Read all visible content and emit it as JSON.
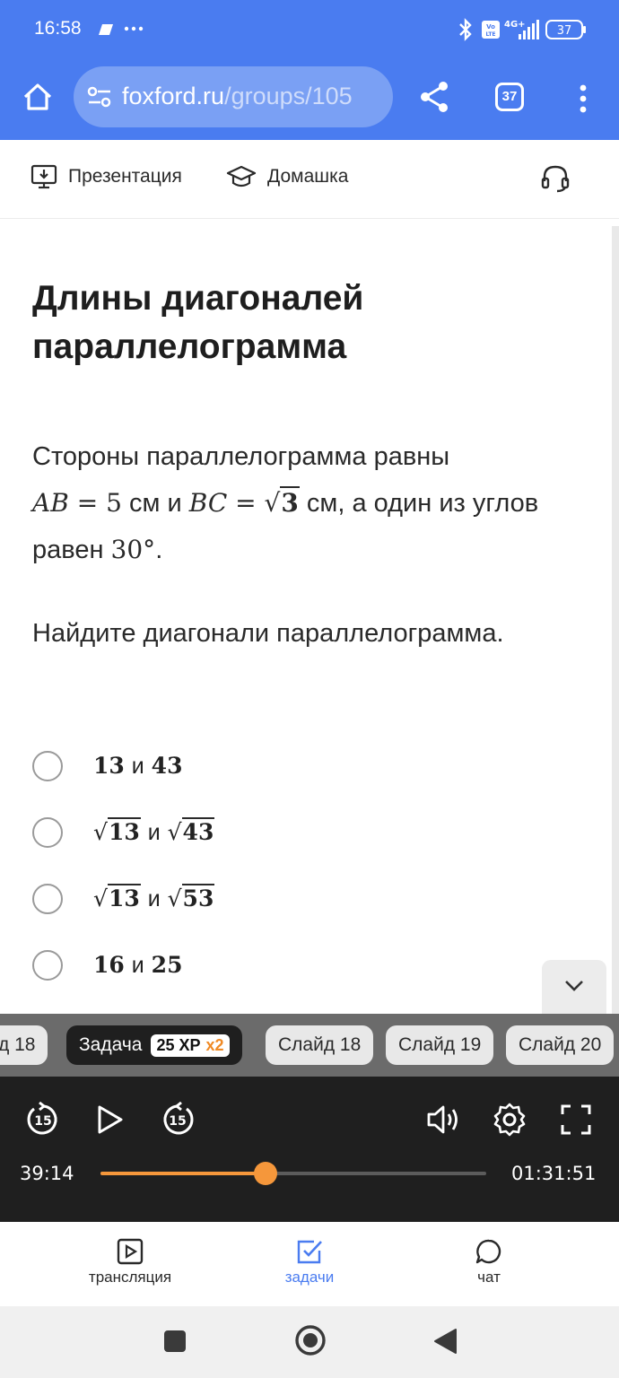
{
  "status_bar": {
    "time": "16:58",
    "battery": "37",
    "icons": [
      "cloud-icon",
      "more-dots-icon",
      "bluetooth-icon",
      "volte-icon",
      "signal-4g-icon",
      "battery-icon"
    ]
  },
  "browser": {
    "url_main": "foxford.ru",
    "url_path": "/groups/105",
    "tab_count": "37",
    "accent": "#4a7cf0"
  },
  "app_header": {
    "presentation": "Презентация",
    "homework": "Домашка"
  },
  "task": {
    "title": "Длины диагоналей параллелограмма",
    "statement": {
      "prefix": "Стороны параллелограмма равны",
      "ab_label": "AB",
      "ab_value": "5",
      "unit": "см",
      "and": "и",
      "bc_label": "BC",
      "bc_value": "3",
      "suffix": ", а один из углов равен",
      "angle": "30°"
    },
    "question": "Найдите диагонали параллелограмма.",
    "options": [
      {
        "a": "13",
        "b": "43",
        "sqrt": false
      },
      {
        "a": "13",
        "b": "43",
        "sqrt": true
      },
      {
        "a": "13",
        "b": "53",
        "sqrt": true
      },
      {
        "a": "16",
        "b": "25",
        "sqrt": false
      }
    ],
    "and_word": "и"
  },
  "slide_strip": {
    "prev_partial": "д 18",
    "active_label": "Задача",
    "xp": "25 XP",
    "multiplier": "x2",
    "slides": [
      "Слайд 18",
      "Слайд 19",
      "Слайд 20"
    ]
  },
  "player": {
    "current_time": "39:14",
    "total_time": "01:31:51",
    "progress_percent": 42.7,
    "skip_seconds": "15",
    "accent": "#f5973b"
  },
  "bottom_nav": {
    "items": [
      "трансляция",
      "задачи",
      "чат"
    ],
    "active": "задачи"
  }
}
